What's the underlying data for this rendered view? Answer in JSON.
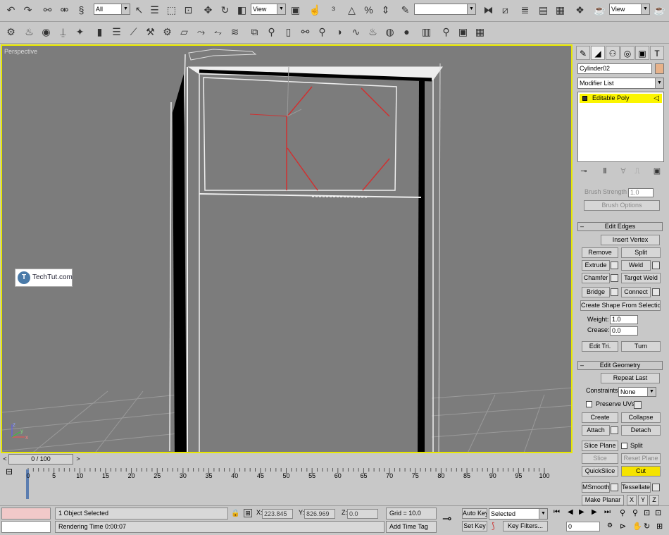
{
  "toolbar": {
    "selection_filter": "All",
    "reference_coord": "View",
    "named_selection": "",
    "view_dropdown": "View"
  },
  "viewport": {
    "label": "Perspective",
    "gizmo_axes": {
      "x": "x",
      "y": "y",
      "z": "z"
    },
    "watermark": "TechTut.com",
    "watermark_logo": "T"
  },
  "command_panel": {
    "object_name": "Cylinder02",
    "object_color": "#e7b28a",
    "modifier_list": "Modifier List",
    "stack_items": [
      "Editable Poly"
    ],
    "brush_strength_label": "Brush Strength",
    "brush_strength_value": "1.0",
    "brush_options": "Brush Options",
    "edit_edges": {
      "title": "Edit Edges",
      "insert_vertex": "Insert Vertex",
      "remove": "Remove",
      "split": "Split",
      "extrude": "Extrude",
      "weld": "Weld",
      "chamfer": "Chamfer",
      "target_weld": "Target Weld",
      "bridge": "Bridge",
      "connect": "Connect",
      "create_shape": "Create Shape From Selection",
      "weight_label": "Weight:",
      "weight_value": "1.0",
      "crease_label": "Crease:",
      "crease_value": "0.0",
      "edit_tri": "Edit Tri.",
      "turn": "Turn"
    },
    "edit_geometry": {
      "title": "Edit Geometry",
      "repeat_last": "Repeat Last",
      "constraints_label": "Constraints:",
      "constraints_value": "None",
      "preserve_uvs": "Preserve UVs",
      "create": "Create",
      "collapse": "Collapse",
      "attach": "Attach",
      "detach": "Detach",
      "slice_plane": "Slice Plane",
      "split": "Split",
      "slice": "Slice",
      "reset_plane": "Reset Plane",
      "quickslice": "QuickSlice",
      "cut": "Cut",
      "msmooth": "MSmooth",
      "tessellate": "Tessellate",
      "make_planar": "Make Planar",
      "x": "X",
      "y": "Y",
      "z": "Z"
    }
  },
  "timeline": {
    "slider": "0 / 100",
    "arrow_left": "<",
    "arrow_right": ">",
    "ticks": [
      "0",
      "5",
      "10",
      "15",
      "20",
      "25",
      "30",
      "35",
      "40",
      "45",
      "50",
      "55",
      "60",
      "65",
      "70",
      "75",
      "80",
      "85",
      "90",
      "95",
      "100"
    ]
  },
  "status": {
    "selected_text": "1 Object Selected",
    "render_text": "Rendering Time  0:00:07",
    "x_label": "X:",
    "x_value": "223.845",
    "y_label": "Y:",
    "y_value": "826.969",
    "z_label": "Z:",
    "z_value": "0.0",
    "grid": "Grid = 10.0",
    "add_time_tag": "Add Time Tag",
    "auto_key": "Auto Key",
    "set_key": "Set Key",
    "selected_dropdown": "Selected",
    "key_filters": "Key Filters...",
    "frame_value": "0"
  }
}
